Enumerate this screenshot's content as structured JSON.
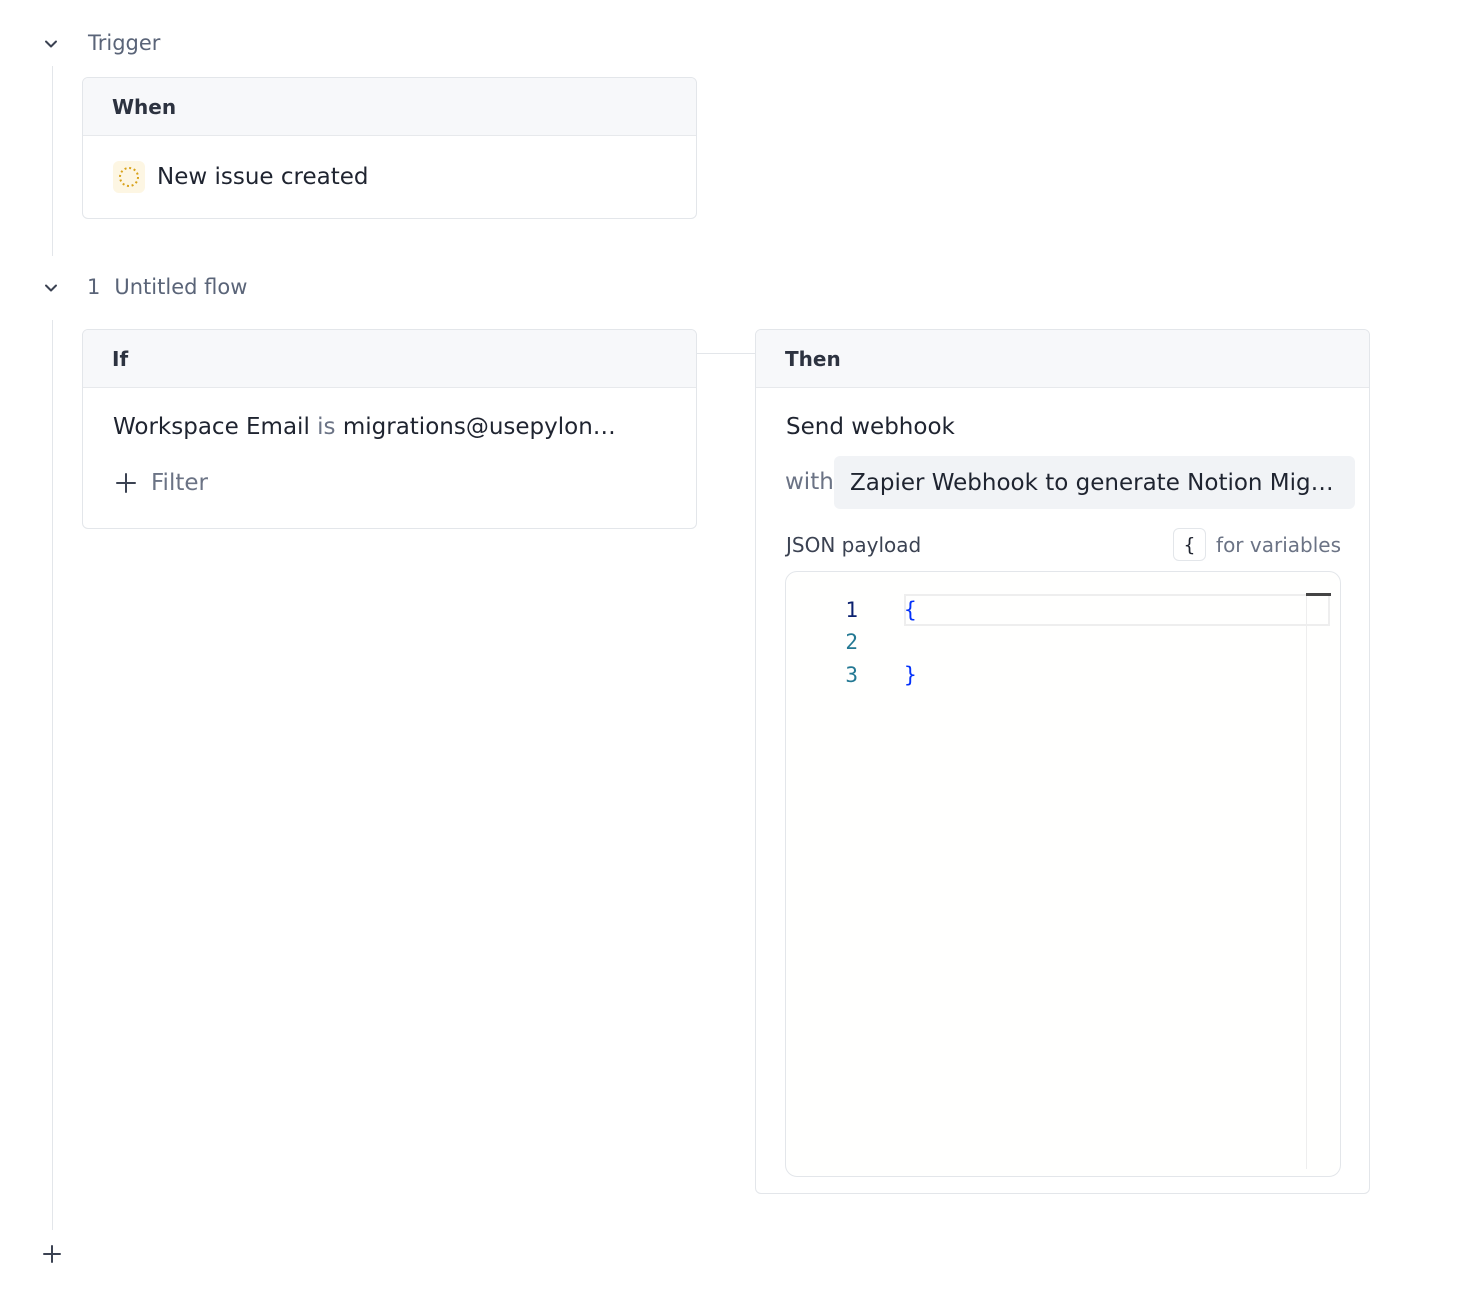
{
  "trigger": {
    "section_title": "Trigger",
    "header": "When",
    "event": "New issue created"
  },
  "flow": {
    "number": "1",
    "title": "Untitled flow",
    "condition": {
      "header": "If",
      "field": "Workspace Email",
      "operator": "is",
      "value": "migrations@usepylon.c…",
      "add_filter_label": "Filter"
    },
    "action": {
      "header": "Then",
      "title": "Send webhook",
      "with_label": "with",
      "webhook": "Zapier Webhook to generate Notion Migra…",
      "payload_label": "JSON payload",
      "vars_key": "{",
      "vars_hint": "for variables",
      "editor": {
        "lines": [
          {
            "no": "1",
            "code": "{"
          },
          {
            "no": "2",
            "code": ""
          },
          {
            "no": "3",
            "code": "}"
          }
        ]
      }
    }
  },
  "icons": {
    "collapse": "chevron-down-icon",
    "issue": "dashed-circle-icon",
    "add": "plus-icon"
  },
  "colors": {
    "issue_icon": "#d8a21a",
    "json_brace": "#0431fa",
    "line_number": "#237893"
  }
}
